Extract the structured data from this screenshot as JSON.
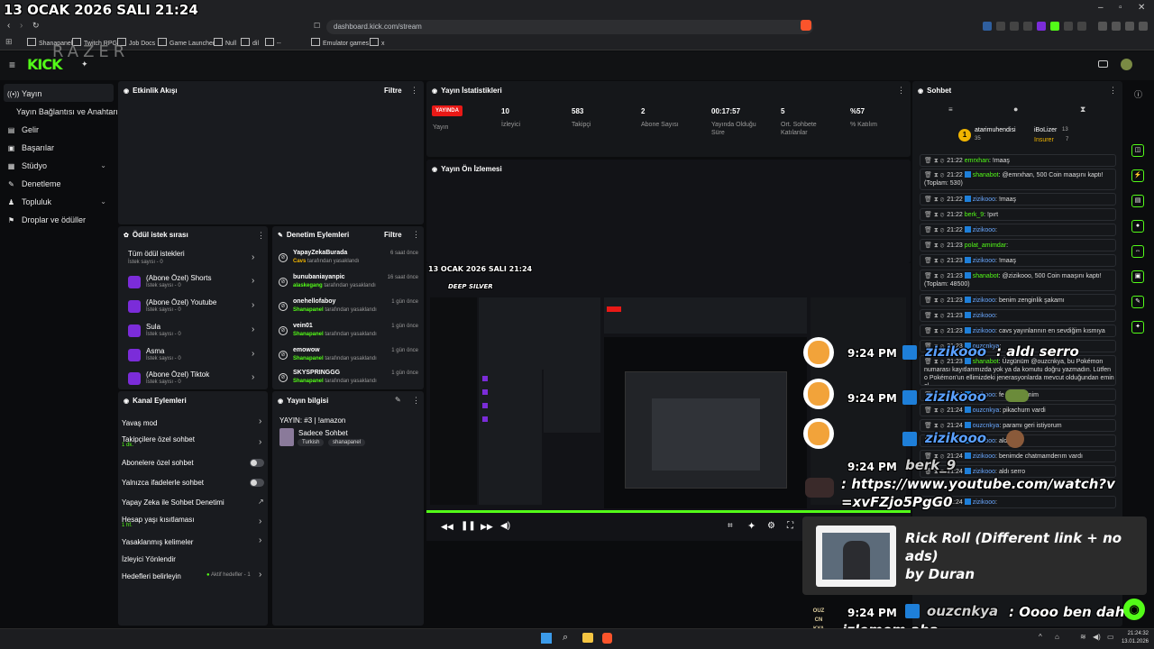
{
  "overlay_datetime": "13 OCAK 2026 SALI 21:24",
  "browser": {
    "url": "dashboard.kick.com/stream",
    "bookmarks": [
      "Shanapanel",
      "Twitch RPG",
      "Job Docs",
      "Game Launcher",
      "Null",
      "dil",
      "--",
      "Emulator games",
      "x"
    ]
  },
  "app": {
    "logo": "KICK",
    "watermark": "RAZER"
  },
  "sidebar": {
    "items": [
      {
        "label": "Yayın",
        "icon": "broadcast-icon"
      },
      {
        "label": "Yayın Bağlantısı ve Anahtarı",
        "icon": ""
      },
      {
        "label": "Gelir",
        "icon": "revenue-icon"
      },
      {
        "label": "Başarılar",
        "icon": "achievements-icon"
      },
      {
        "label": "Stüdyo",
        "icon": "studio-icon"
      },
      {
        "label": "Denetleme",
        "icon": "moderation-icon"
      },
      {
        "label": "Topluluk",
        "icon": "community-icon"
      },
      {
        "label": "Droplar ve ödüller",
        "icon": "drops-icon"
      }
    ]
  },
  "activity_feed": {
    "title": "Etkinlik Akışı",
    "filter": "Filtre"
  },
  "stats": {
    "title": "Yayın İstatistikleri",
    "live_badge": "YAYINDA",
    "live_label": "Yayın",
    "items": [
      {
        "value": "10",
        "label": "İzleyici"
      },
      {
        "value": "583",
        "label": "Takipçi"
      },
      {
        "value": "2",
        "label": "Abone Sayısı"
      },
      {
        "value": "00:17:57",
        "label": "Yayında Olduğu Süre"
      },
      {
        "value": "5",
        "label": "Ort. Sohbete Katılanlar"
      },
      {
        "value": "%57",
        "label": "% Katılım"
      }
    ]
  },
  "preview": {
    "title": "Yayın Ön İzlemesi"
  },
  "rewards": {
    "title": "Ödül istek sırası",
    "items": [
      {
        "name": "Tüm ödül istekleri",
        "count": "İstek sayısı - 0"
      },
      {
        "name": "(Abone Özel) Shorts",
        "count": "İstek sayısı - 0"
      },
      {
        "name": "(Abone Özel) Youtube",
        "count": "İstek sayısı - 0"
      },
      {
        "name": "Sula",
        "count": "İstek sayısı - 0"
      },
      {
        "name": "Asma",
        "count": "İstek sayısı - 0"
      },
      {
        "name": "(Abone Özel) Tiktok",
        "count": "İstek sayısı - 0"
      }
    ]
  },
  "moderation": {
    "title": "Denetim Eylemleri",
    "filter": "Filtre",
    "items": [
      {
        "user": "YapayZekaBurada",
        "by": "Cavs",
        "action": "tarafından yasaklandı",
        "time": "6 saat önce"
      },
      {
        "user": "bunubaniayanpic",
        "by": "alaskegang",
        "action": "tarafından yasaklandı",
        "time": "16 saat önce"
      },
      {
        "user": "onehellofaboy",
        "by": "Shanapanel",
        "action": "tarafından yasaklandı",
        "time": "1 gün önce"
      },
      {
        "user": "vein01",
        "by": "Shanapanel",
        "action": "tarafından yasaklandı",
        "time": "1 gün önce"
      },
      {
        "user": "emowow",
        "by": "Shanapanel",
        "action": "tarafından yasaklandı",
        "time": "1 gün önce"
      },
      {
        "user": "SKYSPRINGGG",
        "by": "Shanapanel",
        "action": "tarafından yasaklandı",
        "time": "1 gün önce"
      }
    ]
  },
  "channel_actions": {
    "title": "Kanal Eylemleri",
    "items": [
      {
        "label": "Yavaş mod",
        "sub": ""
      },
      {
        "label": "Takipçilere özel sohbet",
        "sub": "1 dk."
      },
      {
        "label": "Abonelere özel sohbet",
        "sub": ""
      },
      {
        "label": "Yalnızca ifadelerle sohbet",
        "sub": ""
      },
      {
        "label": "Yapay Zeka ile Sohbet Denetimi",
        "sub": ""
      },
      {
        "label": "Hesap yaşı kısıtlaması",
        "sub": "1 hf."
      },
      {
        "label": "Yasaklanmış kelimeler",
        "sub": ""
      },
      {
        "label": "İzleyici Yönlendir",
        "sub": ""
      },
      {
        "label": "Hedefleri belirleyin",
        "sub": ""
      }
    ],
    "goal_status": "Aktif hedefler - 1"
  },
  "stream_info": {
    "title": "Yayın bilgisi",
    "stream_title": "YAYIN: #3 | !amazon",
    "category": "Sadece Sohbet",
    "tags": [
      "Turkish",
      "shanapanel"
    ]
  },
  "chat": {
    "title": "Sohbet",
    "top_users": [
      {
        "name": "atarimuhendisi",
        "count": "35"
      },
      {
        "name": "iBoLizer",
        "count": "13"
      },
      {
        "name": "Insurer",
        "count": "7"
      }
    ],
    "messages": [
      {
        "time": "21:22",
        "user": "emrxhan",
        "text": "!maaş"
      },
      {
        "time": "21:22",
        "user": "shanabot",
        "text": "@emrxhan, 500 Coin maaşını kaptı! (Toplam: 530)"
      },
      {
        "time": "21:22",
        "user": "zizikooo",
        "text": "!maaş"
      },
      {
        "time": "21:22",
        "user": "berk_9",
        "text": "!pırt"
      },
      {
        "time": "21:22",
        "user": "zizikooo",
        "text": ""
      },
      {
        "time": "21:23",
        "user": "polat_amimdar",
        "text": ""
      },
      {
        "time": "21:23",
        "user": "zizikooo",
        "text": "!maaş"
      },
      {
        "time": "21:23",
        "user": "shanabot",
        "text": "@zizikooo, 500 Coin maaşını kaptı! (Toplam: 48500)"
      },
      {
        "time": "21:23",
        "user": "zizikooo",
        "text": "benim zenginlik şakamı"
      },
      {
        "time": "21:23",
        "user": "zizikooo",
        "text": ""
      },
      {
        "time": "21:23",
        "user": "zizikooo",
        "text": "cavs yayınlarının en sevdiğim kısmıya"
      },
      {
        "time": "21:23",
        "user": "ouzcnkya",
        "text": ""
      },
      {
        "time": "21:23",
        "user": "shanabot",
        "text": "Üzgünüm @ouzcnkya, bu Pokémon numarası kayıtlarımızda yok ya da komutu doğru yazmadın. Lütfen o Pokémon'un ellimizdeki jenerasyonlarda mevcut olduğundan emin ol."
      },
      {
        "time": "21:24",
        "user": "zizikooo",
        "text": "fe vardi benim"
      },
      {
        "time": "21:24",
        "user": "ouzcnkya",
        "text": "pikachurn vardi"
      },
      {
        "time": "21:24",
        "user": "ouzcnkya",
        "text": "paramı geri istiyorum"
      },
      {
        "time": "21:24",
        "user": "zizikooo",
        "text": "aldı ya"
      },
      {
        "time": "21:24",
        "user": "zizikooo",
        "text": "benimde chatmamderım vardı"
      },
      {
        "time": "21:24",
        "user": "zizikooo",
        "text": "aldı serro"
      },
      {
        "time": "21:24",
        "user": "zizikooo",
        "text": ""
      }
    ]
  },
  "overlay": {
    "time": "9:24 PM",
    "msg1_user": "zizikooo",
    "msg1_text": ": aldı serro",
    "msg2_user": "zizikooo",
    "msg3_user": "zizikooo",
    "msg4_user": "berk_9",
    "msg4_text": ": https://www.youtube.com/watch?v=xvFZjo5PgG0",
    "video_title": "Rick Roll (Different link + no ads)",
    "video_author": "by Duran",
    "bottom_user": "ouzcnkya",
    "bottom_text": ": Oooo ben daha izlemem aha",
    "avatar_text": "OUZ CN KYA"
  },
  "inner_preview": {
    "datetime": "13 OCAK 2026 SALI 21:24",
    "brand": "DEEP SILVER"
  },
  "taskbar": {
    "time": "21:24:32",
    "date": "13.01.2026"
  },
  "colors": {
    "accent": "#53fc18",
    "live": "#e91916",
    "panel": "#191b1f"
  }
}
